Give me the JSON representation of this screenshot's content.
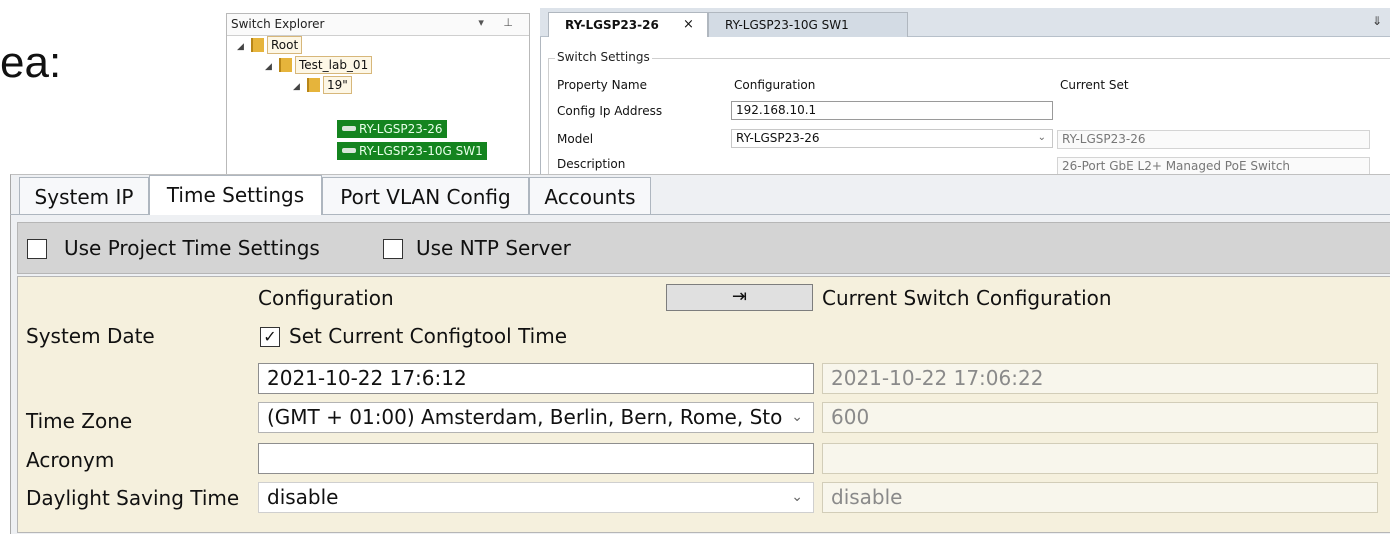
{
  "background_text": "ea:",
  "explorer": {
    "title": "Switch Explorer",
    "tools": "▾ ⊥",
    "tree": {
      "root": "Root",
      "lab": "Test_lab_01",
      "rack": "19\"",
      "switches": [
        "RY-LGSP23-26",
        "RY-LGSP23-10G SW1"
      ]
    }
  },
  "doc_tabs": [
    {
      "label": "RY-LGSP23-26",
      "close": "×",
      "active": true
    },
    {
      "label": "RY-LGSP23-10G SW1",
      "active": false
    }
  ],
  "doc_tabs_overflow": "⇓",
  "switch_settings": {
    "group_title": "Switch Settings",
    "headers": {
      "property": "Property Name",
      "configuration": "Configuration",
      "current": "Current Set"
    },
    "rows": [
      {
        "name": "Config Ip Address",
        "config": "192.168.10.1",
        "current": ""
      },
      {
        "name": "Model",
        "config": "RY-LGSP23-26",
        "current": "RY-LGSP23-26"
      },
      {
        "name": "Description",
        "config": "",
        "current": "26-Port GbE L2+ Managed PoE Switch"
      }
    ]
  },
  "tabs": [
    {
      "label": "System IP",
      "active": false
    },
    {
      "label": "Time Settings",
      "active": true
    },
    {
      "label": "Port VLAN Config",
      "active": false
    },
    {
      "label": "Accounts",
      "active": false
    }
  ],
  "toolbar": {
    "use_project_time": {
      "label": "Use Project Time Settings",
      "checked": false
    },
    "use_ntp": {
      "label": "Use NTP Server",
      "checked": false
    }
  },
  "time_settings": {
    "col_config": "Configuration",
    "sync_button": "⇥",
    "col_current": "Current Switch Configuration",
    "system_date": {
      "label": "System Date",
      "checkbox_label": "Set Current Configtool Time",
      "checked": true,
      "config_value": "2021-10-22 17:6:12",
      "current_value": "2021-10-22 17:06:22"
    },
    "time_zone": {
      "label": "Time Zone",
      "config_value": "(GMT + 01:00) Amsterdam, Berlin, Bern, Rome, Sto",
      "current_value": "600"
    },
    "acronym": {
      "label": "Acronym",
      "config_value": "",
      "current_value": ""
    },
    "dst": {
      "label": "Daylight Saving Time",
      "config_value": "disable",
      "current_value": "disable"
    }
  },
  "icons": {
    "check": "✓",
    "dropdown": "⌄",
    "collapse": "◢"
  }
}
